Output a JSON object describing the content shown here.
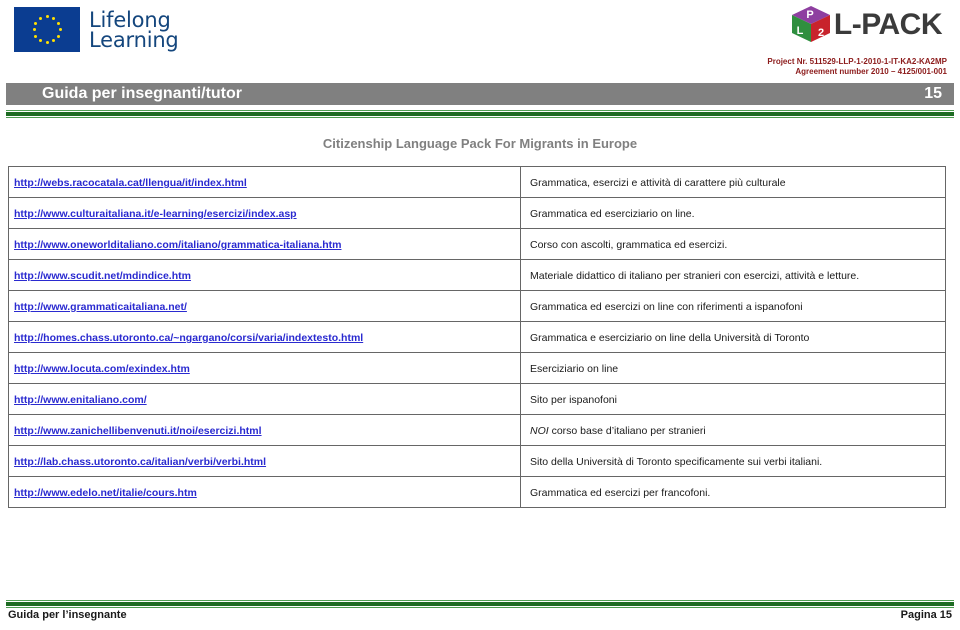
{
  "header": {
    "eu_logo_line1": "Lifelong",
    "eu_logo_line2": "Learning",
    "eu_logo_alt": "eu-flag-icon",
    "lpack_logo_text": "L-PACK",
    "lpack_cube_faces": {
      "top": "P",
      "left": "L",
      "right": "2"
    },
    "project_number": "Project Nr. 511529-LLP-1-2010-1-IT-KA2-KA2MP",
    "agreement_number": "Agreement number 2010 – 4125/001-001",
    "title": "Guida per insegnanti/tutor",
    "page_number": "15"
  },
  "subtitle": "Citizenship Language Pack For Migrants in Europe",
  "table": {
    "rows": [
      {
        "url": "http://webs.racocatala.cat/llengua/it/index.html",
        "desc": "Grammatica, esercizi e attività di carattere più culturale",
        "desc_italic_prefix": ""
      },
      {
        "url": "http://www.culturaitaliana.it/e-learning/esercizi/index.asp",
        "desc": "Grammatica ed eserciziario on line.",
        "desc_italic_prefix": ""
      },
      {
        "url": "http://www.oneworlditaliano.com/italiano/grammatica-italiana.htm",
        "desc": "Corso con ascolti, grammatica ed esercizi.",
        "desc_italic_prefix": ""
      },
      {
        "url": "http://www.scudit.net/mdindice.htm",
        "desc": "Materiale didattico di italiano per stranieri con esercizi, attività e letture.",
        "desc_italic_prefix": ""
      },
      {
        "url": "http://www.grammaticaitaliana.net/",
        "desc": "Grammatica ed esercizi on line con riferimenti a ispanofoni",
        "desc_italic_prefix": ""
      },
      {
        "url": "http://homes.chass.utoronto.ca/~ngargano/corsi/varia/indextesto.html",
        "desc": "Grammatica e eserciziario on line della Università  di Toronto",
        "desc_italic_prefix": ""
      },
      {
        "url": "http://www.locuta.com/exindex.htm",
        "desc": "Eserciziario on line",
        "desc_italic_prefix": ""
      },
      {
        "url": "http://www.enitaliano.com/",
        "desc": "Sito per ispanofoni",
        "desc_italic_prefix": ""
      },
      {
        "url": "http://www.zanichellibenvenuti.it/noi/esercizi.html",
        "desc": " corso base d’italiano per stranieri",
        "desc_italic_prefix": "NOI"
      },
      {
        "url": "http://lab.chass.utoronto.ca/italian/verbi/verbi.html",
        "desc": "Sito della Università di Toronto specificamente sui verbi italiani.",
        "desc_italic_prefix": ""
      },
      {
        "url": "http://www.edelo.net/italie/cours.htm",
        "desc": "Grammatica ed esercizi per francofoni.",
        "desc_italic_prefix": ""
      }
    ]
  },
  "footer": {
    "left": "Guida per l’insegnante",
    "right": "Pagina 15"
  },
  "colors": {
    "eu_blue": "#0b3d91",
    "eu_star_yellow": "#ffe000",
    "title_bar_grey": "#808080",
    "green_thick": "#1d6b22",
    "green_thin": "#4f9e52",
    "project_red": "#8c1b1b",
    "link_blue": "#2a2ad0",
    "subtitle_grey": "#808080"
  }
}
